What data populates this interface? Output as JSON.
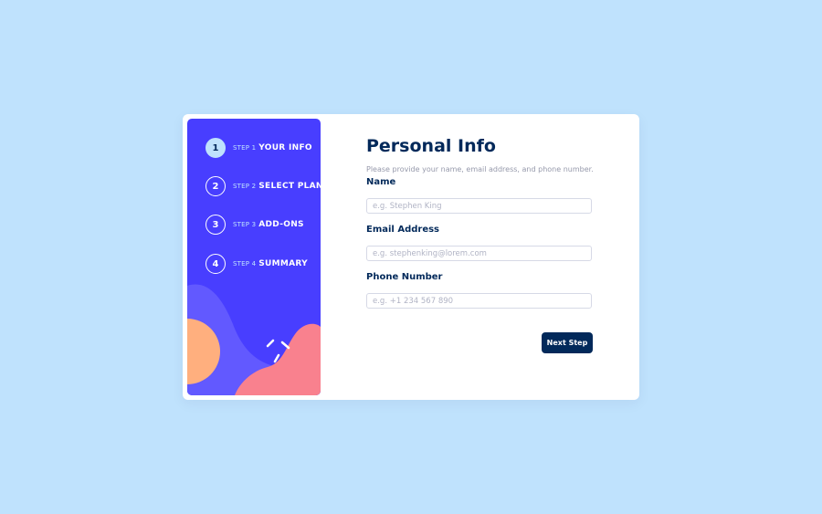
{
  "colors": {
    "page_background": "#bfe2fd",
    "sidebar_background": "#483eff",
    "active_step": "#bfe2fd",
    "marine_blue": "#02295a",
    "cool_gray": "#9699ab",
    "border": "#d6d9e6",
    "shape_orange": "#ffaf7e",
    "shape_pink": "#f9818e",
    "shape_violet": "#6259ff"
  },
  "sidebar": {
    "steps": [
      {
        "number": "1",
        "label": "STEP 1",
        "title": "YOUR INFO",
        "active": true
      },
      {
        "number": "2",
        "label": "STEP 2",
        "title": "SELECT PLAN",
        "active": false
      },
      {
        "number": "3",
        "label": "STEP 3",
        "title": "ADD-ONS",
        "active": false
      },
      {
        "number": "4",
        "label": "STEP 4",
        "title": "SUMMARY",
        "active": false
      }
    ]
  },
  "main": {
    "title": "Personal Info",
    "subtitle": "Please provide your name, email address, and phone number.",
    "fields": {
      "name": {
        "label": "Name",
        "placeholder": "e.g. Stephen King",
        "value": ""
      },
      "email": {
        "label": "Email Address",
        "placeholder": "e.g. stephenking@lorem.com",
        "value": ""
      },
      "phone": {
        "label": "Phone Number",
        "placeholder": "e.g. +1 234 567 890",
        "value": ""
      }
    },
    "next_button_label": "Next Step"
  }
}
